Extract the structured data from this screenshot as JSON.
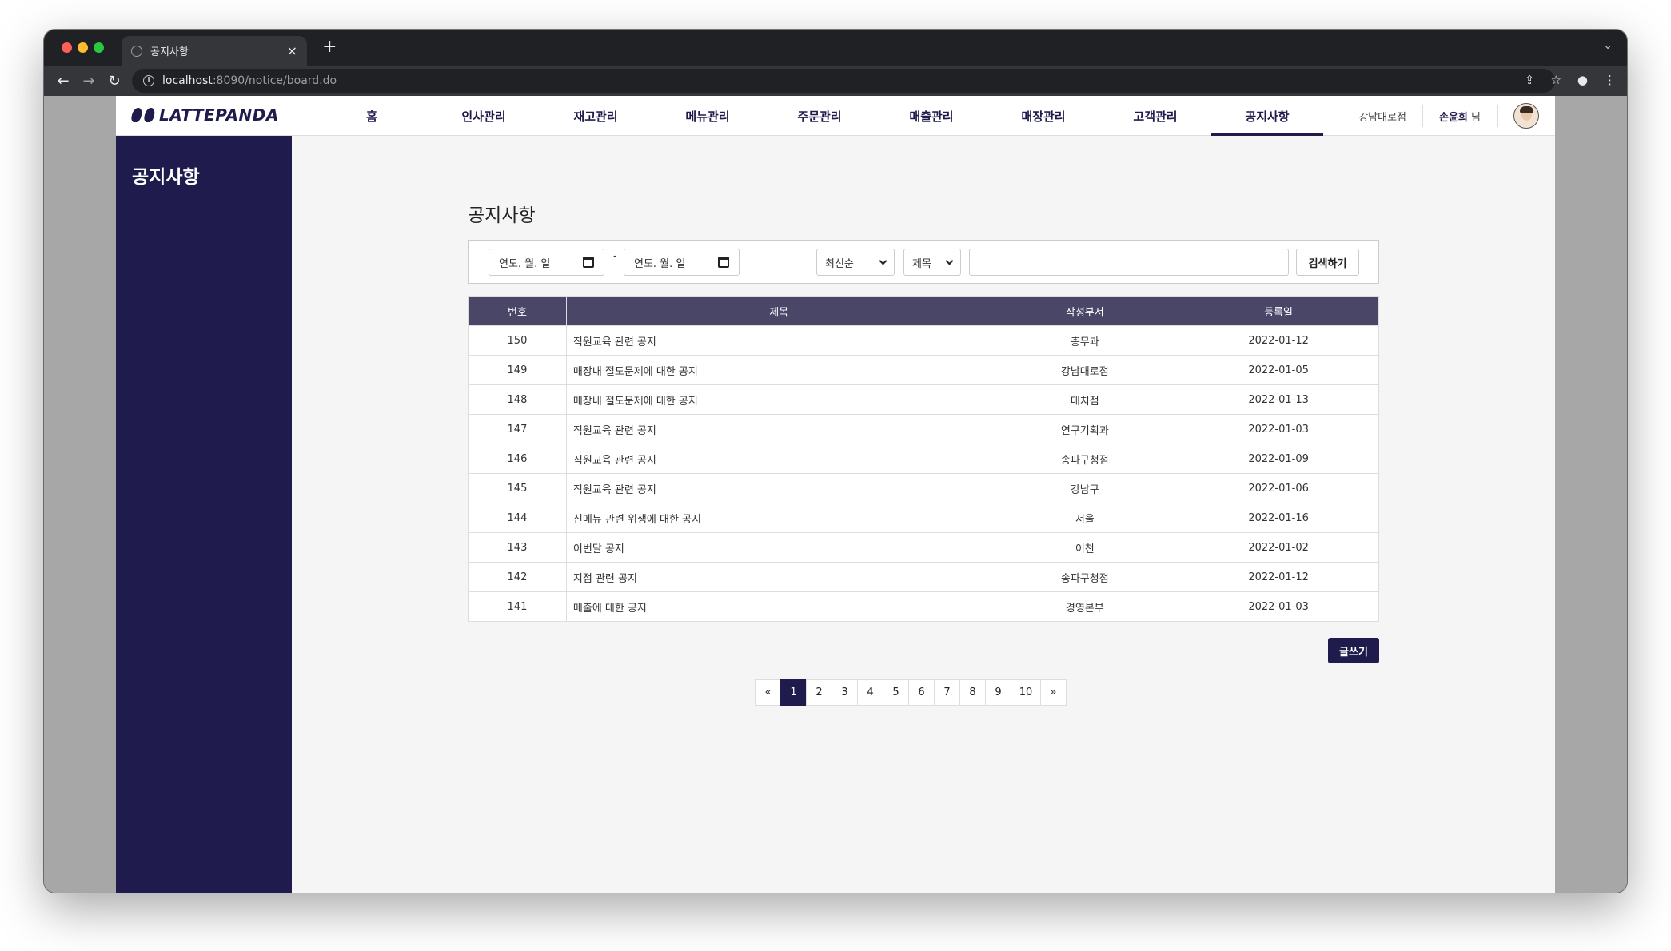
{
  "browser": {
    "tab_title": "공지사항",
    "url_host": "localhost",
    "url_path": ":8090/notice/board.do"
  },
  "nav": {
    "logo_text": "LATTEPANDA",
    "items": [
      "홈",
      "인사관리",
      "재고관리",
      "메뉴관리",
      "주문관리",
      "매출관리",
      "매장관리",
      "고객관리",
      "공지사항"
    ],
    "active_index": 8,
    "store_name": "강남대로점",
    "user_name": "손윤희",
    "user_suffix": "님"
  },
  "sidebar": {
    "title": "공지사항"
  },
  "main": {
    "page_title": "공지사항",
    "search": {
      "date_from_placeholder": "연도. 월. 일",
      "date_to_placeholder": "연도. 월. 일",
      "date_separator": "-",
      "sort_selected": "최신순",
      "field_selected": "제목",
      "keyword_value": "",
      "search_button": "검색하기"
    },
    "table": {
      "headers": [
        "번호",
        "제목",
        "작성부서",
        "등록일"
      ],
      "rows": [
        [
          "150",
          "직원교육 관련 공지",
          "총무과",
          "2022-01-12"
        ],
        [
          "149",
          "매장내 절도문제에 대한 공지",
          "강남대로점",
          "2022-01-05"
        ],
        [
          "148",
          "매장내 절도문제에 대한 공지",
          "대치점",
          "2022-01-13"
        ],
        [
          "147",
          "직원교육 관련 공지",
          "연구기획과",
          "2022-01-03"
        ],
        [
          "146",
          "직원교육 관련 공지",
          "송파구청점",
          "2022-01-09"
        ],
        [
          "145",
          "직원교육 관련 공지",
          "강남구",
          "2022-01-06"
        ],
        [
          "144",
          "신메뉴 관련 위생에 대한 공지",
          "서울",
          "2022-01-16"
        ],
        [
          "143",
          "이번달 공지",
          "이천",
          "2022-01-02"
        ],
        [
          "142",
          "지점 관련 공지",
          "송파구청점",
          "2022-01-12"
        ],
        [
          "141",
          "매출에 대한 공지",
          "경영본부",
          "2022-01-03"
        ]
      ]
    },
    "write_button": "글쓰기",
    "pagination": {
      "prev": "«",
      "pages": [
        "1",
        "2",
        "3",
        "4",
        "5",
        "6",
        "7",
        "8",
        "9",
        "10"
      ],
      "active": "1",
      "next": "»"
    }
  },
  "colors": {
    "brand": "#1f1b4d",
    "table_header": "#4a4668"
  }
}
